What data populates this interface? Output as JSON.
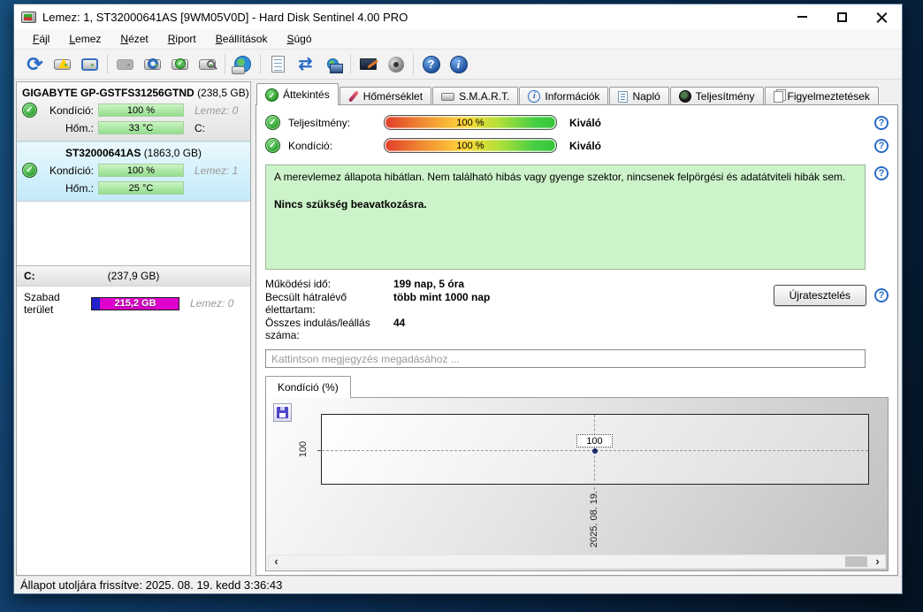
{
  "window": {
    "title": "Lemez: 1, ST32000641AS [9WM05V0D]  -  Hard Disk Sentinel 4.00 PRO"
  },
  "menu": {
    "items": [
      "Fájl",
      "Lemez",
      "Nézet",
      "Riport",
      "Beállítások",
      "Súgó"
    ]
  },
  "toolbar": {
    "icons": [
      "refresh",
      "disk-warning",
      "disk-monitor",
      "disk-disabled",
      "disk-clock",
      "disk-accept",
      "disk-search",
      "disk-globe",
      "report",
      "sync",
      "network-computer",
      "remote-monitor",
      "sound",
      "help",
      "info"
    ]
  },
  "sidebar": {
    "drives": [
      {
        "name": "GIGABYTE GP-GSTFS31256GTND",
        "size": "(238,5 GB)",
        "condition_label": "Kondíció:",
        "condition_value": "100 %",
        "temp_label": "Hőm.:",
        "temp_value": "33 °C",
        "disk_label": "Lemez: 0",
        "partition_letter": "C:"
      },
      {
        "name": "ST32000641AS",
        "size": "(1863,0 GB)",
        "condition_label": "Kondíció:",
        "condition_value": "100 %",
        "temp_label": "Hőm.:",
        "temp_value": "25 °C",
        "disk_label": "Lemez: 1",
        "partition_letter": ""
      }
    ],
    "partition": {
      "name": "C:",
      "size": "(237,9 GB)",
      "free_label": "Szabad terület",
      "free_value": "215,2 GB",
      "disk_label": "Lemez: 0"
    }
  },
  "tabs": [
    {
      "label": "Áttekintés"
    },
    {
      "label": "Hőmérséklet"
    },
    {
      "label": "S.M.A.R.T."
    },
    {
      "label": "Információk"
    },
    {
      "label": "Napló"
    },
    {
      "label": "Teljesítmény"
    },
    {
      "label": "Figyelmeztetések"
    }
  ],
  "overview": {
    "performance_label": "Teljesítmény:",
    "performance_value": "100 %",
    "performance_rating": "Kiváló",
    "condition_label": "Kondíció:",
    "condition_value": "100 %",
    "condition_rating": "Kiváló",
    "status_text": "A merevlemez állapota hibátlan. Nem található hibás vagy gyenge szektor, nincsenek felpörgési és adatátviteli hibák sem.",
    "status_advice": "Nincs szükség beavatkozásra.",
    "stats": [
      {
        "label": "Működési idő:",
        "value": "199 nap, 5 óra"
      },
      {
        "label": "Becsült hátralévő élettartam:",
        "value": "több mint 1000 nap"
      },
      {
        "label": "Összes indulás/leállás száma:",
        "value": "44"
      }
    ],
    "retest_label": "Újratesztelés",
    "comment_placeholder": "Kattintson megjegyzés megadásához ..."
  },
  "chart_data": {
    "type": "line",
    "title": "Kondíció  (%)",
    "x": [
      "2025. 08. 19."
    ],
    "values": [
      100
    ],
    "yticks": [
      "100"
    ],
    "point_labels": [
      "100"
    ],
    "ylim": [
      0,
      200
    ],
    "grid": "dashed",
    "legend": "none"
  },
  "ui": {
    "scroll_left": "‹",
    "scroll_right": "›"
  },
  "statusbar": {
    "text": "Állapot utoljára frissítve: 2025. 08. 19. kedd 3:36:43"
  },
  "colors": {
    "accent_green": "#22aa22",
    "selected_drive_bg": "#cfeef9",
    "status_box_bg": "#ccf2cb",
    "free_space_bar": "#dd00cc",
    "free_space_bar_start": "#2222cc",
    "help_icon_blue": "#2a6bc8",
    "meter_gradient": [
      "#e23b2a",
      "#ffd83a",
      "#36c436"
    ],
    "desktop_bg": "#0e3a66"
  }
}
